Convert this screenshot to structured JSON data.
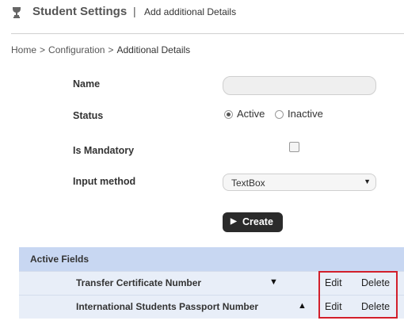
{
  "header": {
    "icon": "trophy-icon",
    "title": "Student Settings",
    "separator": "|",
    "subtitle": "Add additional Details"
  },
  "breadcrumb": {
    "items": [
      "Home",
      "Configuration",
      "Additional Details"
    ],
    "separator": ">"
  },
  "form": {
    "name_label": "Name",
    "name_value": "",
    "status_label": "Status",
    "status_options": [
      "Active",
      "Inactive"
    ],
    "status_selected": "Active",
    "mandatory_label": "Is Mandatory",
    "mandatory_checked": false,
    "input_method_label": "Input method",
    "input_method_value": "TextBox",
    "create_label": "Create"
  },
  "active_fields": {
    "title": "Active Fields",
    "rows": [
      {
        "name": "Transfer Certificate Number",
        "sort": "▼",
        "edit": "Edit",
        "delete": "Delete"
      },
      {
        "name": "International Students Passport Number",
        "sort": "▲",
        "edit": "Edit",
        "delete": "Delete"
      }
    ]
  },
  "colors": {
    "table_header": "#c8d7f2",
    "table_row": "#e8eef8",
    "button_bg": "#2b2b2b",
    "highlight": "#d21f2b"
  }
}
